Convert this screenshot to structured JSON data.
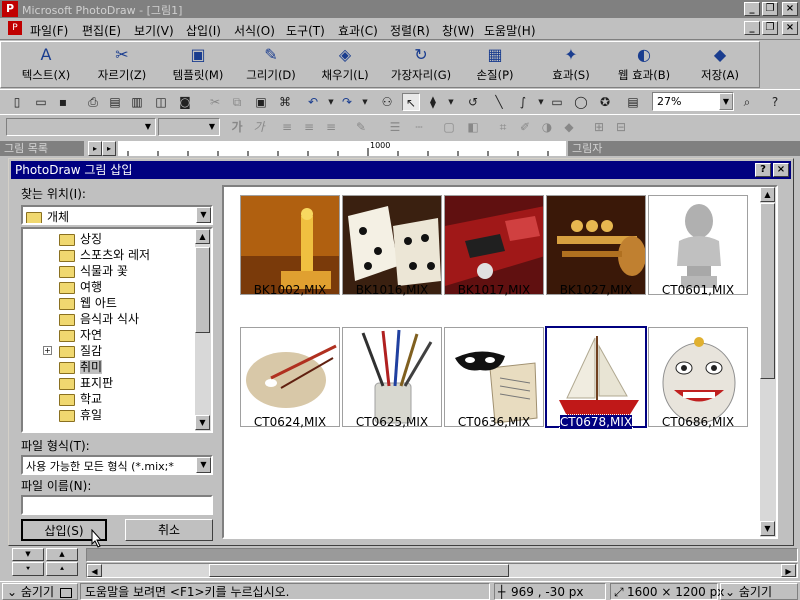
{
  "window": {
    "title": "Microsoft PhotoDraw - [그림1]",
    "app_icon": "photodraw-icon",
    "controls": [
      "_",
      "❐",
      "×"
    ]
  },
  "menu": {
    "items": [
      "파일(F)",
      "편집(E)",
      "보기(V)",
      "삽입(I)",
      "서식(O)",
      "도구(T)",
      "효과(C)",
      "정렬(R)",
      "창(W)",
      "도움말(H)"
    ]
  },
  "big_toolbar": {
    "buttons": [
      {
        "label": "텍스트(X)",
        "icon": "text-icon"
      },
      {
        "label": "자르기(Z)",
        "icon": "scissors-icon"
      },
      {
        "label": "템플릿(M)",
        "icon": "template-icon"
      },
      {
        "label": "그리기(D)",
        "icon": "draw-icon"
      },
      {
        "label": "채우기(L)",
        "icon": "fill-icon"
      },
      {
        "label": "가장자리(G)",
        "icon": "edge-icon"
      },
      {
        "label": "손질(P)",
        "icon": "touchup-icon"
      },
      {
        "label": "효과(S)",
        "icon": "effects-icon"
      },
      {
        "label": "웹 효과(B)",
        "icon": "web-effects-icon"
      },
      {
        "label": "저장(A)",
        "icon": "save-icon"
      }
    ]
  },
  "standard_toolbar": {
    "zoom": "27%"
  },
  "panes": {
    "picture_list": "그림 목록",
    "ruler_mark": "1000",
    "scratch": "그림자"
  },
  "dialog": {
    "title": "PhotoDraw 그림 삽입",
    "look_in_label": "찾는 위치(I):",
    "look_in_value": "개체",
    "folders": [
      {
        "name": "상징",
        "expandable": false,
        "selected": false
      },
      {
        "name": "스포츠와 레저",
        "expandable": false,
        "selected": false
      },
      {
        "name": "식물과 꽃",
        "expandable": false,
        "selected": false
      },
      {
        "name": "여행",
        "expandable": false,
        "selected": false
      },
      {
        "name": "웹 아트",
        "expandable": false,
        "selected": false
      },
      {
        "name": "음식과 식사",
        "expandable": false,
        "selected": false
      },
      {
        "name": "자연",
        "expandable": false,
        "selected": false
      },
      {
        "name": "질감",
        "expandable": true,
        "selected": false
      },
      {
        "name": "취미",
        "expandable": false,
        "selected": true
      },
      {
        "name": "표지판",
        "expandable": false,
        "selected": false
      },
      {
        "name": "학교",
        "expandable": false,
        "selected": false
      },
      {
        "name": "휴일",
        "expandable": false,
        "selected": false
      }
    ],
    "file_type_label": "파일 형식(T):",
    "file_type_value": "사용 가능한 모든 형식 (*.mix;*",
    "file_name_label": "파일 이름(N):",
    "file_name_value": "",
    "insert_button": "삽입(S)",
    "cancel_button": "취소",
    "thumbnails": [
      {
        "name": "BK1002,MIX",
        "selected": false,
        "icon": "trophy-photo"
      },
      {
        "name": "BK1016,MIX",
        "selected": false,
        "icon": "dice-photo"
      },
      {
        "name": "BK1017,MIX",
        "selected": false,
        "icon": "board-game-photo"
      },
      {
        "name": "BK1027,MIX",
        "selected": false,
        "icon": "trumpet-photo"
      },
      {
        "name": "CT0601,MIX",
        "selected": false,
        "icon": "bust-statue-photo"
      },
      {
        "name": "CT0624,MIX",
        "selected": false,
        "icon": "palette-photo"
      },
      {
        "name": "CT0625,MIX",
        "selected": false,
        "icon": "brushes-jar-photo"
      },
      {
        "name": "CT0636,MIX",
        "selected": false,
        "icon": "mask-book-photo"
      },
      {
        "name": "CT0678,MIX",
        "selected": true,
        "icon": "sailboat-photo"
      },
      {
        "name": "CT0686,MIX",
        "selected": false,
        "icon": "tribal-mask-photo"
      }
    ]
  },
  "status_bar": {
    "left": "숨기기",
    "help": "도움말을 보려면 <F1>키를 누르십시오.",
    "coords": "969 , -30  px",
    "size": "1600 × 1200  px",
    "right": "숨기기"
  }
}
